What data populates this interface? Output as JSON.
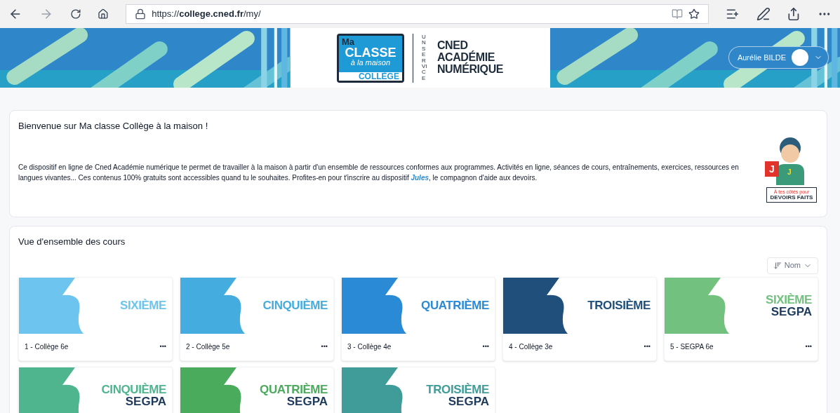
{
  "browser": {
    "url_prefix": "https://",
    "url_host": "college.cned.fr",
    "url_path": "/my/"
  },
  "banner": {
    "logo": {
      "ma": "Ma",
      "classe": "CLASSE",
      "maison": "à la maison",
      "college": "COLLÈGE"
    },
    "service": "UN SERVICE",
    "brand_lines": [
      "CNED",
      "ACADÉMIE",
      "NUMÉRIQUE"
    ],
    "user_name": "Aurélie BILDE"
  },
  "welcome": {
    "title": "Bienvenue sur Ma classe Collège à la maison !",
    "text_before": "Ce dispositif en ligne de Cned Académie numérique te permet de travailler à la maison à partir d'un ensemble de ressources conformes aux programmes. Activités en ligne, séances de cours, entraînements, exercices, ressources en langues vivantes... Ces contenus 100% gratuits sont accessibles quand tu le souhaites. Profites-en pour t'inscrire au dispositif",
    "link": "Jules",
    "text_after": ", le compagnon d'aide aux devoirs.",
    "badge": {
      "letter": "J",
      "shirt_letter": "J",
      "caption": "À tes côtés pour",
      "title": "DEVOIRS FAITS"
    }
  },
  "courses": {
    "title": "Vue d'ensemble des cours",
    "sort": "Nom",
    "items": [
      {
        "name": "SIXIÈME",
        "title": "1 - Collège 6e",
        "color": "#6cc4ef",
        "menu": "•••"
      },
      {
        "name": "CINQUIÈME",
        "title": "2 - Collège 5e",
        "color": "#45ace0",
        "menu": "•••"
      },
      {
        "name": "QUATRIÈME",
        "title": "3 - Collège 4e",
        "color": "#2a8ad6",
        "menu": "•••"
      },
      {
        "name": "TROISIÈME",
        "title": "4 - Collège 3e",
        "color": "#1f4f7a",
        "menu": "•••"
      },
      {
        "name": "SIXIÈME",
        "sub": "SEGPA",
        "title": "5 - SEGPA 6e",
        "color": "#72c17f",
        "menu": "•••"
      },
      {
        "name": "CINQUIÈME",
        "sub": "SEGPA",
        "color": "#4fb58e"
      },
      {
        "name": "QUATRIÈME",
        "sub": "SEGPA",
        "color": "#4aab5c"
      },
      {
        "name": "TROISIÈME",
        "sub": "SEGPA",
        "color": "#3f9c98"
      }
    ]
  }
}
